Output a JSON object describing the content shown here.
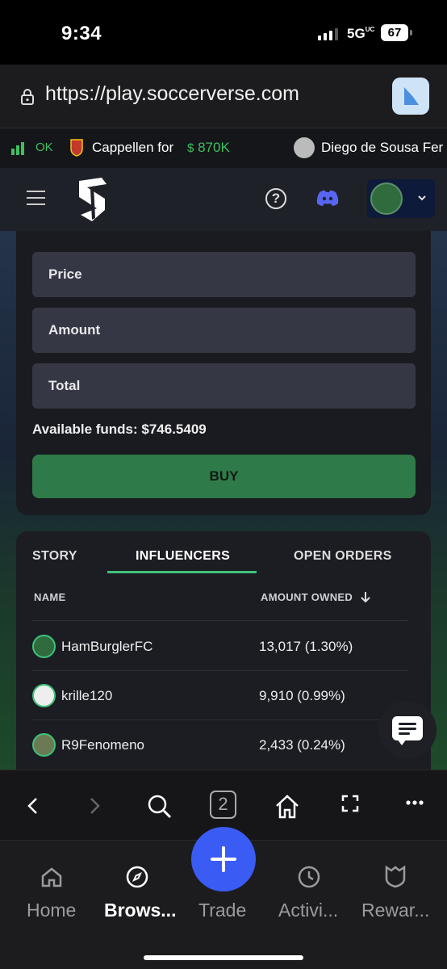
{
  "status_bar": {
    "time": "9:34",
    "network": "5G",
    "network_suffix": "UC",
    "battery": "67"
  },
  "browser": {
    "url": "https://play.soccerverse.com"
  },
  "ticker": {
    "items": [
      {
        "text": "OK",
        "color": "#3fbf5f"
      },
      {
        "text": "Cappellen for",
        "color": "#ffffff"
      },
      {
        "text": "870K",
        "color": "#3fbf5f"
      },
      {
        "text": "Diego de Sousa Fer",
        "color": "#ffffff"
      }
    ]
  },
  "order_form": {
    "price_placeholder": "Price",
    "amount_placeholder": "Amount",
    "total_placeholder": "Total",
    "available_funds": "Available funds: $746.5409",
    "buy_label": "BUY"
  },
  "tabs": [
    "STORY",
    "INFLUENCERS",
    "OPEN ORDERS"
  ],
  "active_tab": "INFLUENCERS",
  "table": {
    "headers": {
      "name": "NAME",
      "amount": "AMOUNT OWNED"
    },
    "rows": [
      {
        "name": "HamBurglerFC",
        "amount": "13,017 (1.30%)"
      },
      {
        "name": "krille120",
        "amount": "9,910 (0.99%)"
      },
      {
        "name": "R9Fenomeno",
        "amount": "2,433 (0.24%)"
      }
    ]
  },
  "browser_toolbar": {
    "tabs_count": "2"
  },
  "bottom_nav": {
    "items": [
      {
        "label": "Home",
        "icon": "home-icon"
      },
      {
        "label": "Brows...",
        "icon": "compass-icon"
      },
      {
        "label": "Trade",
        "icon": "plus-icon"
      },
      {
        "label": "Activi...",
        "icon": "clock-icon"
      },
      {
        "label": "Rewar...",
        "icon": "shield-icon"
      }
    ],
    "active": "Brows..."
  },
  "colors": {
    "accent_green": "#3ec27a",
    "buy_button": "#2e7a48",
    "fab_blue": "#3b5bf5",
    "discord": "#5865f2"
  }
}
